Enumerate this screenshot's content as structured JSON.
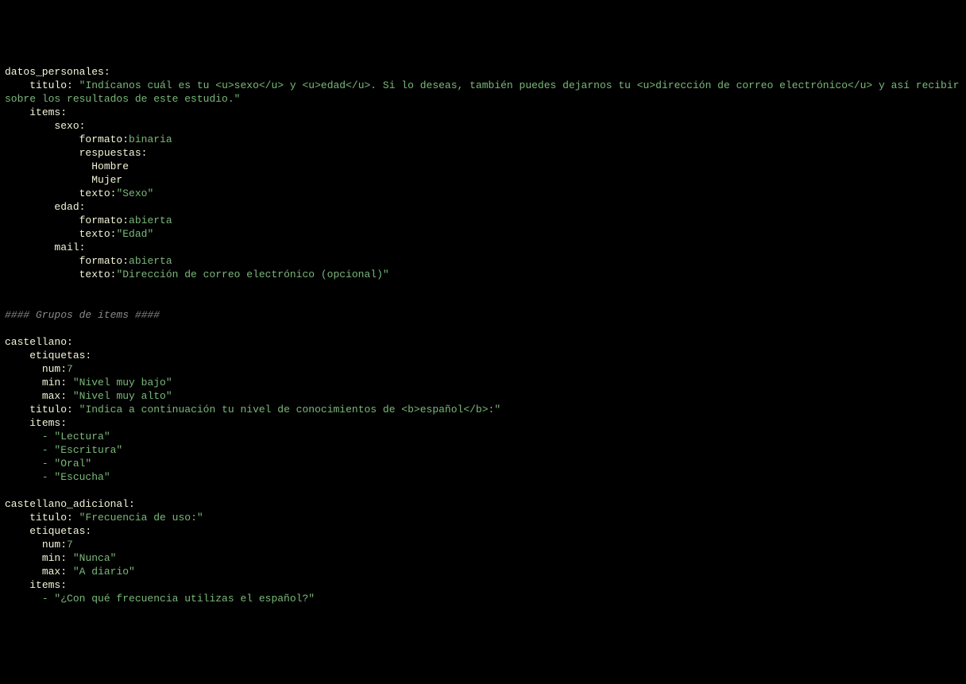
{
  "datos_personales": {
    "key": "datos_personales:",
    "titulo_key": "titulo:",
    "titulo_val": "\"Indícanos cuál es tu <u>sexo</u> y <u>edad</u>. Si lo deseas, también puedes dejarnos tu <u>dirección de correo electrónico</u> y así recibir información",
    "titulo_val2": "sobre los resultados de este estudio.\"",
    "items_key": "items:",
    "sexo": {
      "key": "sexo:",
      "formato_key": "formato:",
      "formato_val": "binaria",
      "respuestas_key": "respuestas:",
      "r1": "Hombre",
      "r2": "Mujer",
      "texto_key": "texto:",
      "texto_val": "\"Sexo\""
    },
    "edad": {
      "key": "edad:",
      "formato_key": "formato:",
      "formato_val": "abierta",
      "texto_key": "texto:",
      "texto_val": "\"Edad\""
    },
    "mail": {
      "key": "mail:",
      "formato_key": "formato:",
      "formato_val": "abierta",
      "texto_key": "texto:",
      "texto_val": "\"Dirección de correo electrónico (opcional)\""
    }
  },
  "section_comment": "#### Grupos de items ####",
  "castellano": {
    "key": "castellano:",
    "etiquetas_key": "etiquetas:",
    "num_key": "num:",
    "num_val": "7",
    "min_key": "min:",
    "min_val": "\"Nivel muy bajo\"",
    "max_key": "max:",
    "max_val": "\"Nivel muy alto\"",
    "titulo_key": "titulo:",
    "titulo_val": "\"Indica a continuación tu nivel de conocimientos de <b>español</b>:\"",
    "items_key": "items:",
    "items": {
      "i1": "- \"Lectura\"",
      "i2": "- \"Escritura\"",
      "i3": "- \"Oral\"",
      "i4": "- \"Escucha\""
    }
  },
  "castellano_adicional": {
    "key": "castellano_adicional:",
    "titulo_key": "titulo:",
    "titulo_val": "\"Frecuencia de uso:\"",
    "etiquetas_key": "etiquetas:",
    "num_key": "num:",
    "num_val": "7",
    "min_key": "min:",
    "min_val": "\"Nunca\"",
    "max_key": "max:",
    "max_val": "\"A diario\"",
    "items_key": "items:",
    "items": {
      "i1": "- \"¿Con qué frecuencia utilizas el español?\""
    }
  }
}
